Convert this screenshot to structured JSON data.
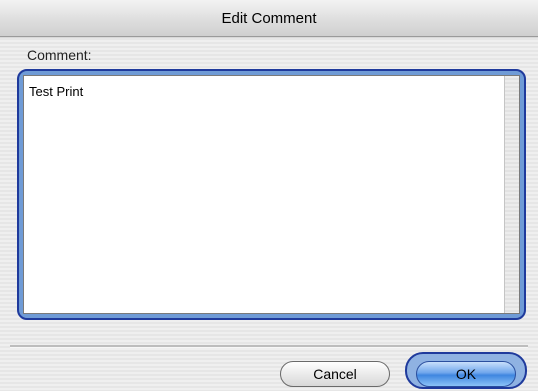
{
  "dialog": {
    "title": "Edit Comment",
    "field_label": "Comment:",
    "comment_value": "Test Print",
    "cancel_label": "Cancel",
    "ok_label": "OK"
  },
  "colors": {
    "focus_ring": "#1f3a9c",
    "default_button": "#3f86e0"
  }
}
